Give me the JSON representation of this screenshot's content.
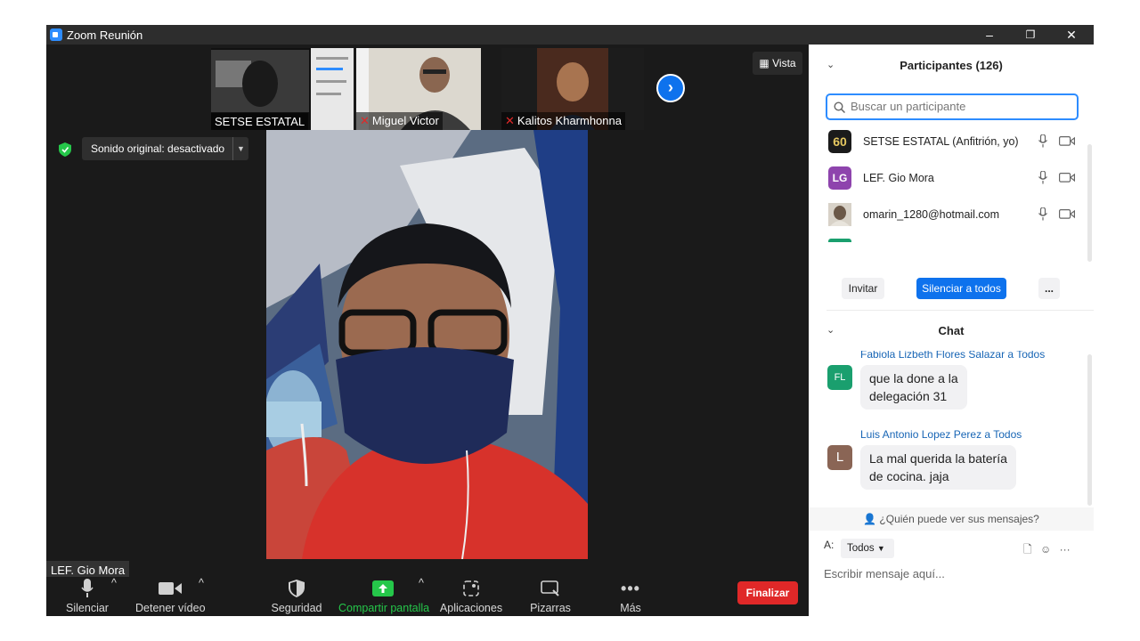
{
  "window": {
    "title": "Zoom Reunión",
    "minimize": "–",
    "restore": "❐",
    "close": "✕"
  },
  "thumbnails": [
    {
      "name": "SETSE ESTATAL",
      "muted": false
    },
    {
      "name": "Miguel Victor",
      "muted": true
    },
    {
      "name": "Kalitos Kharmhonna",
      "muted": true
    }
  ],
  "view": {
    "label": "Vista"
  },
  "audio_banner": {
    "label": "Sonido original: desactivado"
  },
  "active_speaker": {
    "name": "LEF. Gio Mora"
  },
  "toolbar": {
    "mute": "Silenciar",
    "video": "Detener vídeo",
    "security": "Seguridad",
    "share": "Compartir pantalla",
    "apps": "Aplicaciones",
    "whiteboards": "Pizarras",
    "more": "Más",
    "end": "Finalizar"
  },
  "participants": {
    "title": "Participantes (126)",
    "search_placeholder": "Buscar un participante",
    "list": [
      {
        "initials": "60",
        "name": "SETSE ESTATAL (Anfitrión, yo)",
        "color": "#1b1b1b"
      },
      {
        "initials": "LG",
        "name": "LEF. Gio Mora",
        "color": "#8e44ad"
      },
      {
        "initials": "",
        "name": "omarin_1280@hotmail.com",
        "color": "#9a8e80"
      }
    ],
    "invite": "Invitar",
    "mute_all": "Silenciar a todos",
    "more": "..."
  },
  "chat": {
    "title": "Chat",
    "messages": [
      {
        "initials": "FL",
        "color": "#1a9f6e",
        "header": "Fabiola Lizbeth Flores Salazar a Todos",
        "text_line1": "que la done a la",
        "text_line2": "delegación 31"
      },
      {
        "initials": "L",
        "color": "#8a6555",
        "header": "Luis Antonio Lopez Perez a Todos",
        "text_line1": "La mal querida la batería",
        "text_line2": "de cocina. jaja"
      }
    ],
    "visibility": "¿Quién puede ver sus mensajes?",
    "to_label": "A:",
    "recipient": "Todos",
    "composer_placeholder": "Escribir mensaje aquí..."
  },
  "colors": {
    "accent": "#2d8cff",
    "end": "#e02828",
    "share": "#25c74a"
  }
}
